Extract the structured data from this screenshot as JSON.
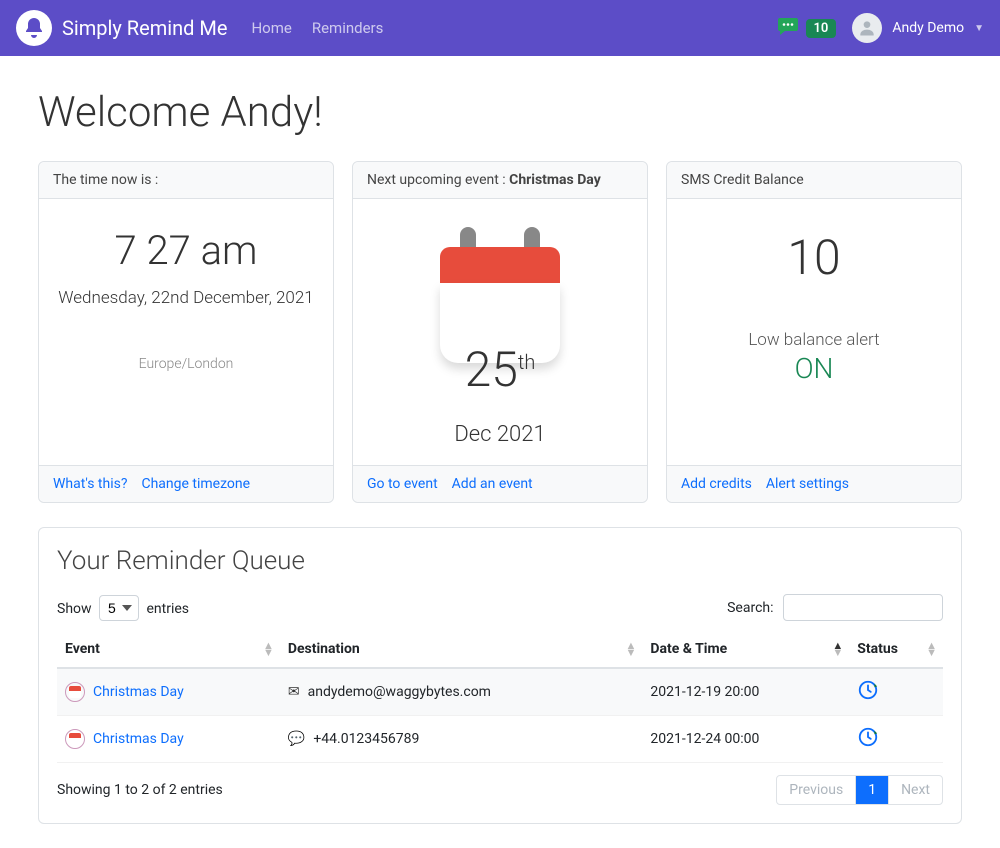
{
  "nav": {
    "brand": "Simply Remind Me",
    "links": [
      "Home",
      "Reminders"
    ],
    "badge": "10",
    "user": "Andy Demo"
  },
  "welcome": "Welcome Andy!",
  "card_time": {
    "header": "The time now is :",
    "time": "7 27 am",
    "date": "Wednesday, 22nd December, 2021",
    "tz": "Europe/London",
    "links": [
      "What's this?",
      "Change timezone"
    ]
  },
  "card_event": {
    "header_prefix": "Next upcoming event : ",
    "header_name": "Christmas Day",
    "day": "25",
    "ord": "th",
    "monthyr": "Dec 2021",
    "links": [
      "Go to event",
      "Add an event"
    ]
  },
  "card_credit": {
    "header": "SMS Credit Balance",
    "amount": "10",
    "alert_label": "Low balance alert",
    "alert_state": "ON",
    "links": [
      "Add credits",
      "Alert settings"
    ]
  },
  "queue": {
    "title": "Your Reminder Queue",
    "length_pre": "Show",
    "length_val": "5",
    "length_post": "entries",
    "search_label": "Search:",
    "cols": [
      "Event",
      "Destination",
      "Date & Time",
      "Status"
    ],
    "rows": [
      {
        "event": "Christmas Day",
        "dest_text": "andydemo@waggybytes.com",
        "dest_type": "email",
        "dt": "2021-12-19 20:00"
      },
      {
        "event": "Christmas Day",
        "dest_text": "+44.0123456789",
        "dest_type": "sms",
        "dt": "2021-12-24 00:00"
      }
    ],
    "info": "Showing 1 to 2 of 2 entries",
    "paginate": {
      "prev": "Previous",
      "page": "1",
      "next": "Next"
    }
  }
}
